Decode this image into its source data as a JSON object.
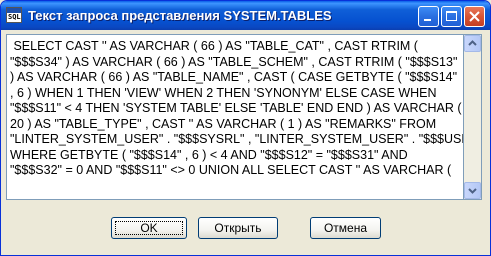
{
  "window": {
    "title": "Текст запроса представления SYSTEM.TABLES",
    "app_icon_text": "SQL"
  },
  "sql_lines": [
    " SELECT CAST '' AS VARCHAR ( 66 ) AS \"TABLE_CAT\" , CAST RTRIM (",
    "\"$$$S34\" ) AS VARCHAR ( 66 ) AS \"TABLE_SCHEM\" , CAST RTRIM ( \"$$$S13\"",
    ") AS VARCHAR ( 66 ) AS \"TABLE_NAME\" , CAST ( CASE GETBYTE ( \"$$$S14\"",
    ", 6 ) WHEN 1 THEN 'VIEW' WHEN 2 THEN 'SYNONYM' ELSE CASE WHEN",
    "\"$$$S11\" < 4 THEN 'SYSTEM TABLE' ELSE 'TABLE' END END ) AS VARCHAR (",
    "20 ) AS \"TABLE_TYPE\" , CAST '' AS VARCHAR ( 1 ) AS \"REMARKS\" FROM",
    "\"LINTER_SYSTEM_USER\" . \"$$$SYSRL\" , \"LINTER_SYSTEM_USER\" . \"$$$USR\"",
    "WHERE GETBYTE ( \"$$$S14\" , 6 ) < 4 AND \"$$$S12\" = \"$$$S31\" AND",
    "\"$$$S32\" = 0 AND \"$$$S11\" <> 0 UNION ALL SELECT CAST '' AS VARCHAR ("
  ],
  "buttons": {
    "ok": "OK",
    "open": "Открыть",
    "cancel": "Отмена"
  }
}
